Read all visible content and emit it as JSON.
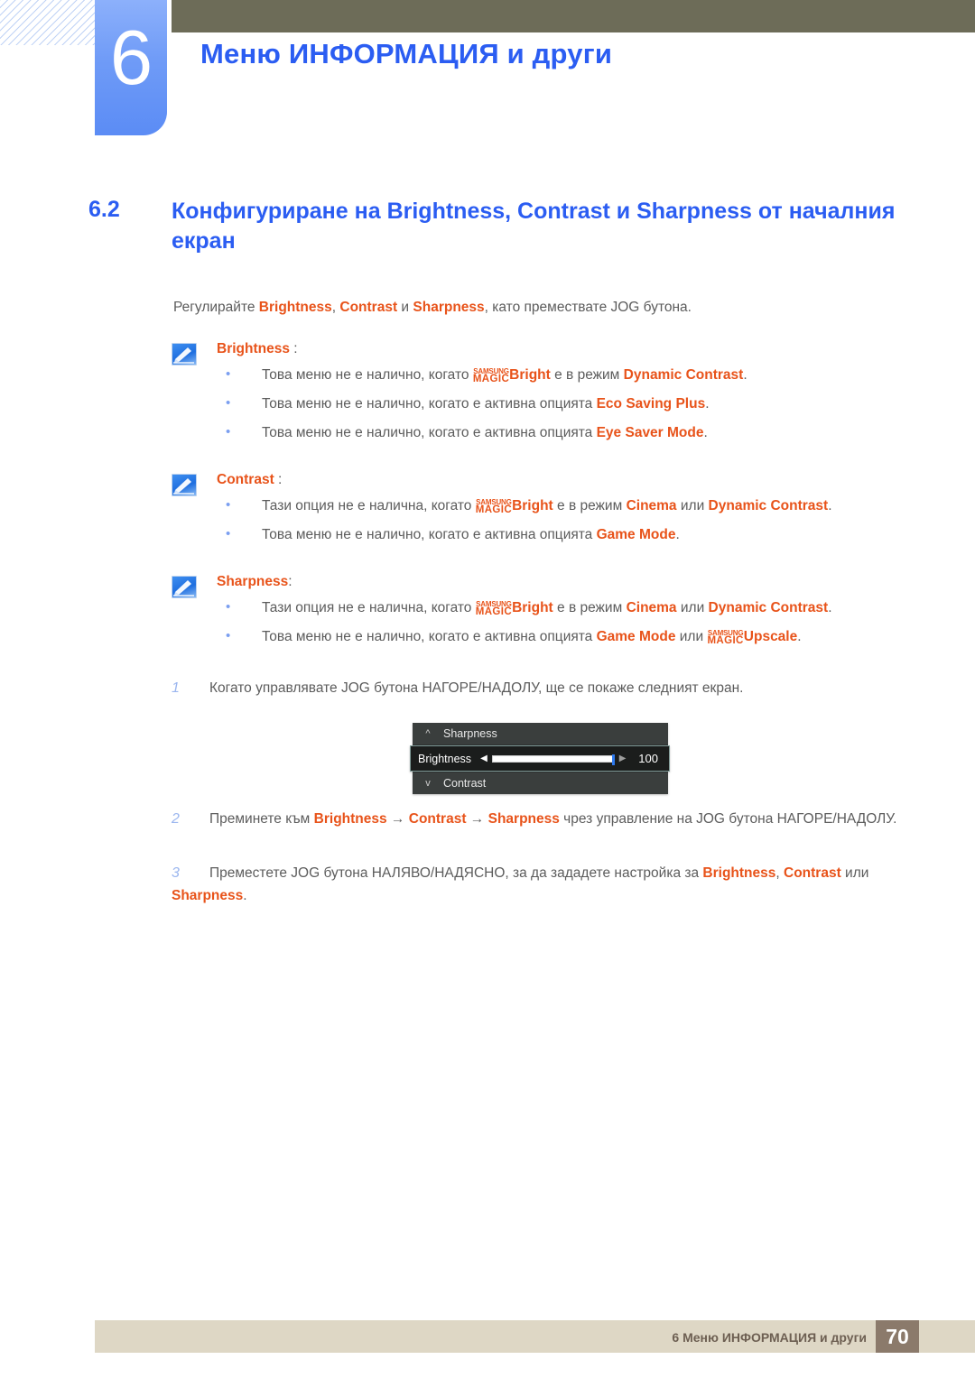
{
  "header": {
    "chapter_number": "6",
    "chapter_title": "Меню ИНФОРМАЦИЯ и други",
    "accent_blue": "#2b5df2",
    "bar_color": "#6d6c58"
  },
  "section": {
    "number": "6.2",
    "title": "Конфигуриране на Brightness, Contrast и Sharpness от началния екран"
  },
  "intro": {
    "prefix": "Регулирайте ",
    "term1": "Brightness",
    "sep1": ", ",
    "term2": "Contrast",
    "sep2": " и ",
    "term3": "Sharpness",
    "suffix": ", като премествате JOG бутона."
  },
  "notes": [
    {
      "icon": "note-pencil-icon",
      "title": "Brightness",
      "colon": " :",
      "bullets": [
        {
          "pre": "Това меню не е налично, когато ",
          "logo_top": "SAMSUNG",
          "logo_bottom": "MAGIC",
          "logo_suffix": "Bright",
          "mid": " е в режим ",
          "term": "Dynamic Contrast",
          "post": "."
        },
        {
          "pre": "Това меню не е налично, когато е активна опцията ",
          "term": "Eco Saving Plus",
          "post": "."
        },
        {
          "pre": "Това меню не е налично, когато е активна опцията ",
          "term": "Eye Saver Mode",
          "post": "."
        }
      ]
    },
    {
      "icon": "note-pencil-icon",
      "title": "Contrast",
      "colon": " :",
      "bullets": [
        {
          "pre": "Тази опция не е налична, когато ",
          "logo_top": "SAMSUNG",
          "logo_bottom": "MAGIC",
          "logo_suffix": "Bright",
          "mid": " е в режим ",
          "term": "Cinema",
          "mid2": " или ",
          "term2": "Dynamic Contrast",
          "post": "."
        },
        {
          "pre": "Това меню не е налично, когато е активна опцията ",
          "term": "Game Mode",
          "post": "."
        }
      ]
    },
    {
      "icon": "note-pencil-icon",
      "title": "Sharpness",
      "colon": ":",
      "bullets": [
        {
          "pre": "Тази опция не е налична, когато ",
          "logo_top": "SAMSUNG",
          "logo_bottom": "MAGIC",
          "logo_suffix": "Bright",
          "mid": " е в режим ",
          "term": "Cinema",
          "mid2": " или ",
          "term2": "Dynamic Contrast",
          "post": "."
        },
        {
          "pre": "Това меню не е налично, когато е активна опцията ",
          "term": "Game Mode",
          "mid2": " или ",
          "logo2_top": "SAMSUNG",
          "logo2_bottom": "MAGIC",
          "logo2_suffix": "Upscale",
          "post": "."
        }
      ]
    }
  ],
  "steps": [
    {
      "number": "1",
      "text": "Когато управлявате JOG бутона НАГОРЕ/НАДОЛУ, ще се покаже следният екран."
    },
    {
      "number": "2",
      "pre": "Преминете към ",
      "t1": "Brightness",
      "a1": " → ",
      "t2": "Contrast",
      "a2": " → ",
      "t3": "Sharpness",
      "post": " чрез управление на JOG бутона НАГОРЕ/НАДОЛУ."
    },
    {
      "number": "3",
      "pre": "Преместете JOG бутона НАЛЯВО/НАДЯСНО, за да зададете настройка за ",
      "t1": "Brightness",
      "a1": ", ",
      "t2": "Contrast",
      "a2": " или ",
      "t3": "Sharpness",
      "post": "."
    }
  ],
  "osd": {
    "row_top_label": "Sharpness",
    "row_top_icon": "chevron-up-icon",
    "row_bottom_label": "Contrast",
    "row_bottom_icon": "chevron-down-icon",
    "selected_label": "Brightness",
    "arrow_left": "◀",
    "arrow_right": "▶",
    "value": "100",
    "slider_percent": 100,
    "bg_color": "#3a3e3d",
    "selected_bg": "#1b1d1c",
    "knob_color": "#2f7bf0"
  },
  "footer": {
    "text": "6 Меню ИНФОРМАЦИЯ и други",
    "page": "70",
    "bar_color": "#ded7c5",
    "page_box_color": "#8b7a6b"
  }
}
